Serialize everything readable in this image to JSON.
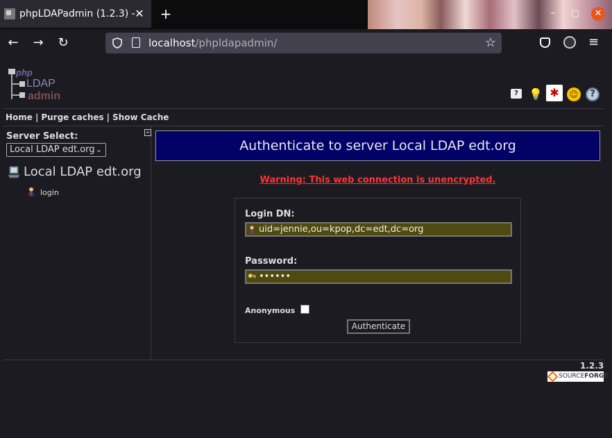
{
  "browser": {
    "tab_title": "phpLDAPadmin (1.2.3) -",
    "tab_close": "✕",
    "new_tab": "+",
    "url_host": "localhost",
    "url_path": "/phpldapadmin/",
    "icons": [
      "shield-icon",
      "page-icon",
      "star-icon",
      "pocket-icon",
      "extension-icon",
      "menu-icon"
    ]
  },
  "header": {
    "logo_text_top": "php",
    "logo_text_mid": "LDAP",
    "logo_text_bot": "admin",
    "icons": [
      "help-icon",
      "idea-icon",
      "bug-icon",
      "smiley-icon",
      "question-icon"
    ]
  },
  "toplinks": {
    "home": "Home",
    "purge": "Purge caches",
    "show_cache": "Show Cache",
    "separator": "|"
  },
  "sidebar": {
    "server_select_label": "Server Select:",
    "server_select_value": "Local LDAP edt.org",
    "server_name": "Local LDAP edt.org",
    "login_link": "login"
  },
  "main": {
    "title": "Authenticate to server Local LDAP edt.org",
    "warning": "Warning: This web connection is unencrypted.",
    "login_dn_label": "Login DN:",
    "login_dn_value": "uid=jennie,ou=kpop,dc=edt,dc=org",
    "password_label": "Password:",
    "password_value": "••••••",
    "anonymous_label": "Anonymous",
    "anonymous_checked": false,
    "authenticate_button": "Authenticate"
  },
  "footer": {
    "version": "1.2.3",
    "sf_source": "SOURCE",
    "sf_forge": "FORGE"
  },
  "colors": {
    "page_bg": "#1c1b22",
    "title_box": "#000066",
    "warning": "#ff3333",
    "field_bg": "#4f4a10",
    "window_close": "#e95420"
  }
}
